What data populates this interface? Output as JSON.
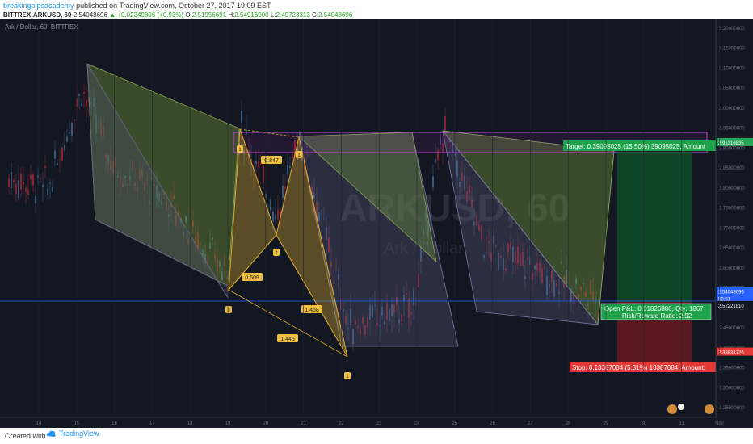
{
  "header": {
    "author": "breakingpipsacademy",
    "published_text": " published on TradingView.com, October 27, 2017 19:09 EST"
  },
  "ohlc": {
    "symbol": "BITTREX:ARKUSD, 60",
    "last": "2.54048696",
    "change": "▲ +0.02349806 (+0.93%)",
    "o_label": "O:",
    "o": "2.51956691",
    "h_label": "H:",
    "h": "2.54916000",
    "l_label": "L:",
    "l": "2.49723313",
    "c_label": "C:",
    "c": "2.54048696"
  },
  "chart_title": "Ark / Dollar, 60, BITTREX",
  "watermark": {
    "main": "ARKUSD, 60",
    "sub": "Ark / Dollar"
  },
  "chart_data": {
    "type": "line",
    "x_ticks": [
      "14",
      "15",
      "16",
      "17",
      "18",
      "19",
      "20",
      "21",
      "22",
      "23",
      "24",
      "25",
      "26",
      "27",
      "28",
      "29",
      "30",
      "31",
      "Nov"
    ],
    "y_ticks": [
      "3.20000000",
      "3.15000000",
      "3.10000000",
      "3.05000000",
      "3.00000000",
      "2.95000000",
      "2.90000000",
      "2.85000000",
      "2.80000000",
      "2.75000000",
      "2.70000000",
      "2.65000000",
      "2.60000000",
      "2.55000000",
      "2.50000000",
      "2.45000000",
      "2.40000000",
      "2.35000000",
      "2.30000000",
      "2.25000000"
    ],
    "ylim": [
      2.25,
      3.2
    ],
    "price_labels": [
      {
        "value": 2.91316835,
        "text": "2.91316835",
        "color": "#26a65b"
      },
      {
        "value": 2.54048696,
        "text": "2.54048696",
        "color": "#2962ff"
      },
      {
        "value": 2.522,
        "text": "50:51",
        "color": "#2962ff"
      },
      {
        "value": 2.505,
        "text": "2.52221810",
        "color": "#131722"
      },
      {
        "value": 2.38834726,
        "text": "2.38834726",
        "color": "#e53935"
      }
    ],
    "harmonic_labels": [
      {
        "name": "X",
        "text": "0"
      },
      {
        "name": "A",
        "text": "1"
      },
      {
        "name": "B",
        "text": "4"
      },
      {
        "name": "C",
        "text": "1"
      },
      {
        "name": "D",
        "text": "1"
      }
    ],
    "ratios": [
      "0.847",
      "0.609",
      "1.458",
      "1.446"
    ],
    "position": {
      "target": "Target: 0.39095025 (15.50%) 39095025, Amount",
      "stop": "Stop: 0.13387084 (5.31%) 13387084, Amount:",
      "open_pl": "Open P&L: 0.01826886, Qty: 1867",
      "rr": "Risk/Reward Ratio: 2.92"
    }
  },
  "footer": {
    "created_with": "Created with",
    "brand": "TradingView"
  }
}
